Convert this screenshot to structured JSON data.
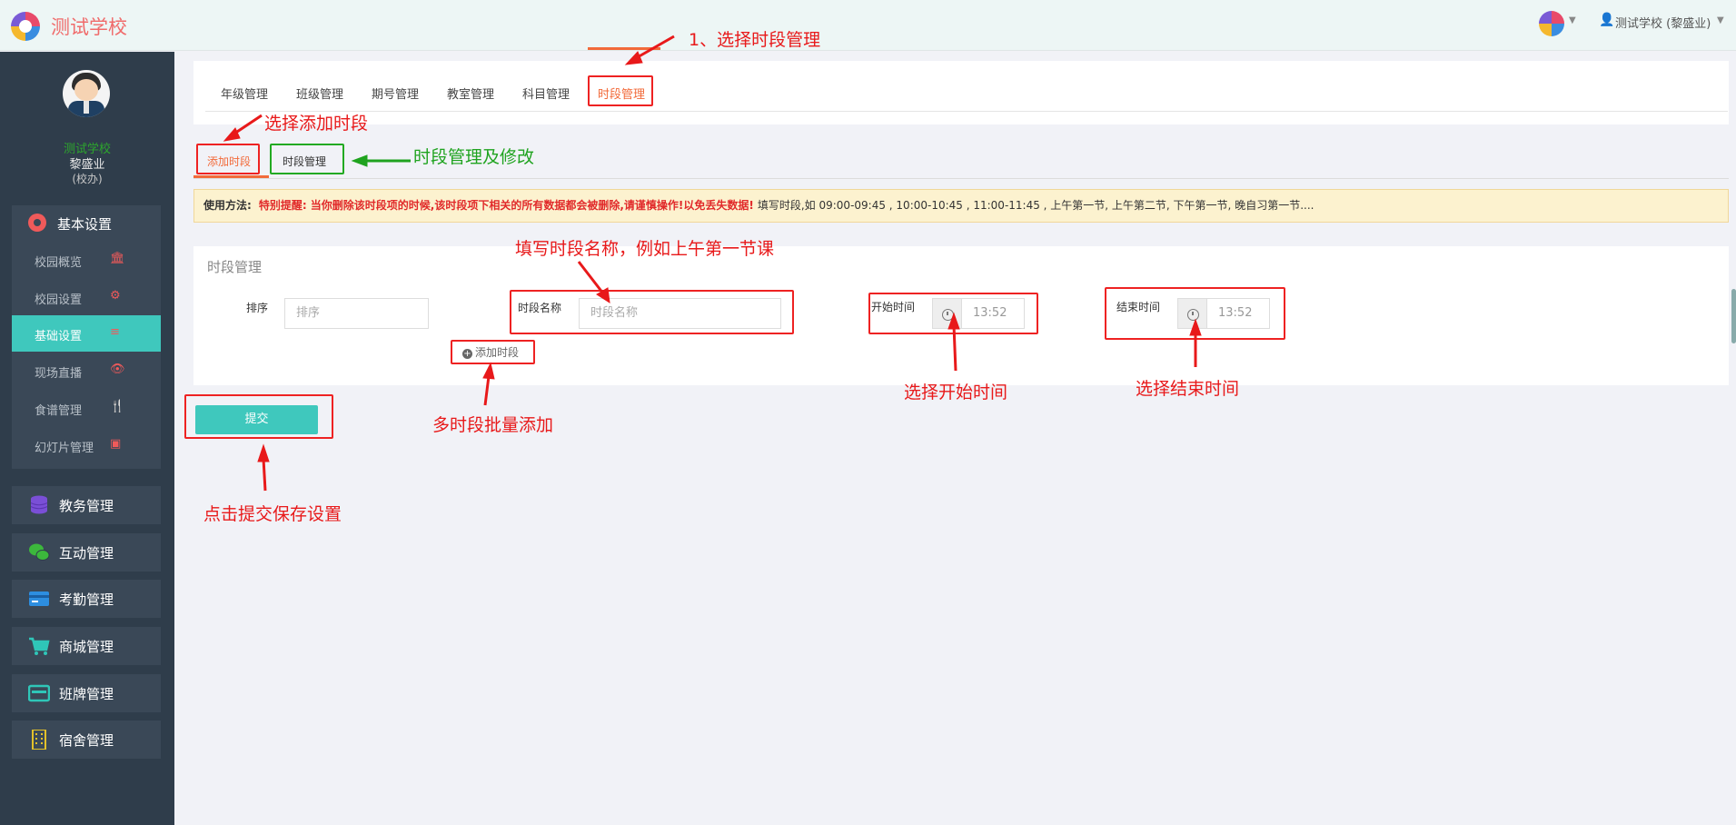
{
  "header": {
    "brand": "测试学校",
    "user": "测试学校 (黎盛业)"
  },
  "sidebar": {
    "school": "测试学校",
    "name": "黎盛业",
    "role": "(校办)",
    "basic_settings": {
      "label": "基本设置",
      "items": [
        {
          "label": "校园概览",
          "icon": "bank-icon"
        },
        {
          "label": "校园设置",
          "icon": "gear-icon"
        },
        {
          "label": "基础设置",
          "icon": "list-icon"
        },
        {
          "label": "现场直播",
          "icon": "eye-icon"
        },
        {
          "label": "食谱管理",
          "icon": "cutlery-icon"
        },
        {
          "label": "幻灯片管理",
          "icon": "image-icon"
        }
      ]
    },
    "modules": [
      {
        "label": "教务管理",
        "icon": "database-icon",
        "color": "#7a4fd6"
      },
      {
        "label": "互动管理",
        "icon": "wechat-icon",
        "color": "#3cb83c"
      },
      {
        "label": "考勤管理",
        "icon": "card-icon",
        "color": "#2d8ee0"
      },
      {
        "label": "商城管理",
        "icon": "cart-icon",
        "color": "#2fc6b8"
      },
      {
        "label": "班牌管理",
        "icon": "board-icon",
        "color": "#2fc6b8"
      },
      {
        "label": "宿舍管理",
        "icon": "building-icon",
        "color": "#e3c12a"
      }
    ]
  },
  "tabs": [
    "年级管理",
    "班级管理",
    "期号管理",
    "教室管理",
    "科目管理",
    "时段管理"
  ],
  "subtabs": [
    "添加时段",
    "时段管理"
  ],
  "notice": {
    "label": "使用方法:",
    "warning": "特别提醒: 当你删除该时段项的时候,该时段项下相关的所有数据都会被删除,请谨慎操作!以免丢失数据!",
    "text": "填写时段,如 09:00-09:45 , 10:00-10:45 , 11:00-11:45 , 上午第一节, 上午第二节, 下午第一节, 晚自习第一节...."
  },
  "form": {
    "title": "时段管理",
    "sort_label": "排序",
    "sort_placeholder": "排序",
    "name_label": "时段名称",
    "name_placeholder": "时段名称",
    "start_label": "开始时间",
    "start_value": "13:52",
    "end_label": "结束时间",
    "end_value": "13:52",
    "add_link": "添加时段",
    "submit": "提交"
  },
  "annotations": {
    "step1": "1、选择时段管理",
    "select_add": "选择添加时段",
    "manage_edit": "时段管理及修改",
    "fill_name": "填写时段名称，例如上午第一节课",
    "pick_start": "选择开始时间",
    "pick_end": "选择结束时间",
    "batch_add": "多时段批量添加",
    "save": "点击提交保存设置"
  },
  "colors": {
    "accent": "#3fc8bd",
    "active_tab": "#f26a3a",
    "annotation_red": "#e8191a",
    "annotation_green": "#1fa31f",
    "sidebar_bg": "#2f3d4b"
  }
}
